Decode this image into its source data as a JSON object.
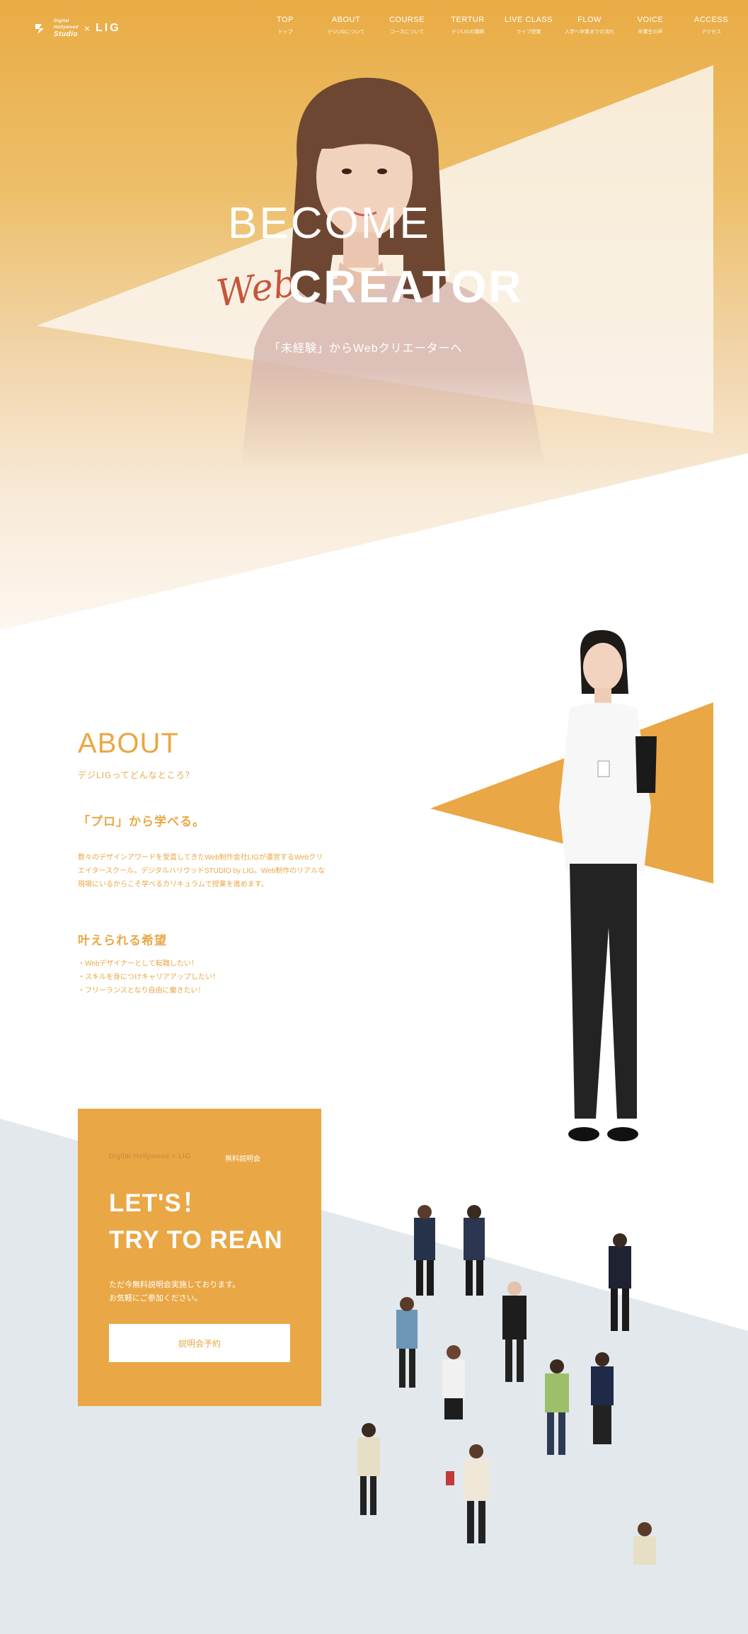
{
  "brand": {
    "logo_text_line1": "Digital",
    "logo_text_line2": "Hollywood",
    "logo_text_line3": "Studio",
    "separator": "×",
    "partner": "LIG"
  },
  "nav": [
    {
      "label": "TOP",
      "sub": "トップ"
    },
    {
      "label": "ABOUT",
      "sub": "デジLIGについて"
    },
    {
      "label": "COURSE",
      "sub": "コースについて"
    },
    {
      "label": "TERTUR",
      "sub": "デジLIGの講師"
    },
    {
      "label": "LIVE CLASS",
      "sub": "ライブ授業"
    },
    {
      "label": "FLOW",
      "sub": "入学へ卒業までの流れ"
    },
    {
      "label": "VOICE",
      "sub": "卒業生の声"
    },
    {
      "label": "ACCESS",
      "sub": "アクセス"
    }
  ],
  "hero": {
    "line1": "BECOME",
    "web": "Web",
    "creator": "CREATOR",
    "subtitle": "「未経験」からWebクリエーターへ"
  },
  "about": {
    "title": "ABOUT",
    "subtitle": "デジLIGってどんなところ？",
    "heading1": "「プロ」から学べる。",
    "paragraph": "数々のデザインアワードを受賞してきたWeb制作会社LIGが運営するWebクリエイタースクール。デジタルハリウッドSTUDIO by LIG。Web制作のリアルな現場にいるからこそ学べるカリキュラムで授業を進めます。",
    "heading2": "叶えられる希望",
    "wishes": [
      "・Webデザイナーとして転職したい！",
      "・スキルを身につけキャリアアップしたい！",
      "・フリーランスとなり自由に働きたい！"
    ]
  },
  "seminar": {
    "brand": "Digital Hollywood × LIG",
    "tag": "無料説明会",
    "title_line1": "LET'S！",
    "title_line2": "TRY TO REAN",
    "desc_line1": "ただ今無料説明会実施しております。",
    "desc_line2": "お気軽にご参加ください。",
    "button": "説明会予約"
  },
  "colors": {
    "accent": "#e9a745",
    "accent_red": "#c7553b",
    "band_grey": "#e3e8ec"
  }
}
